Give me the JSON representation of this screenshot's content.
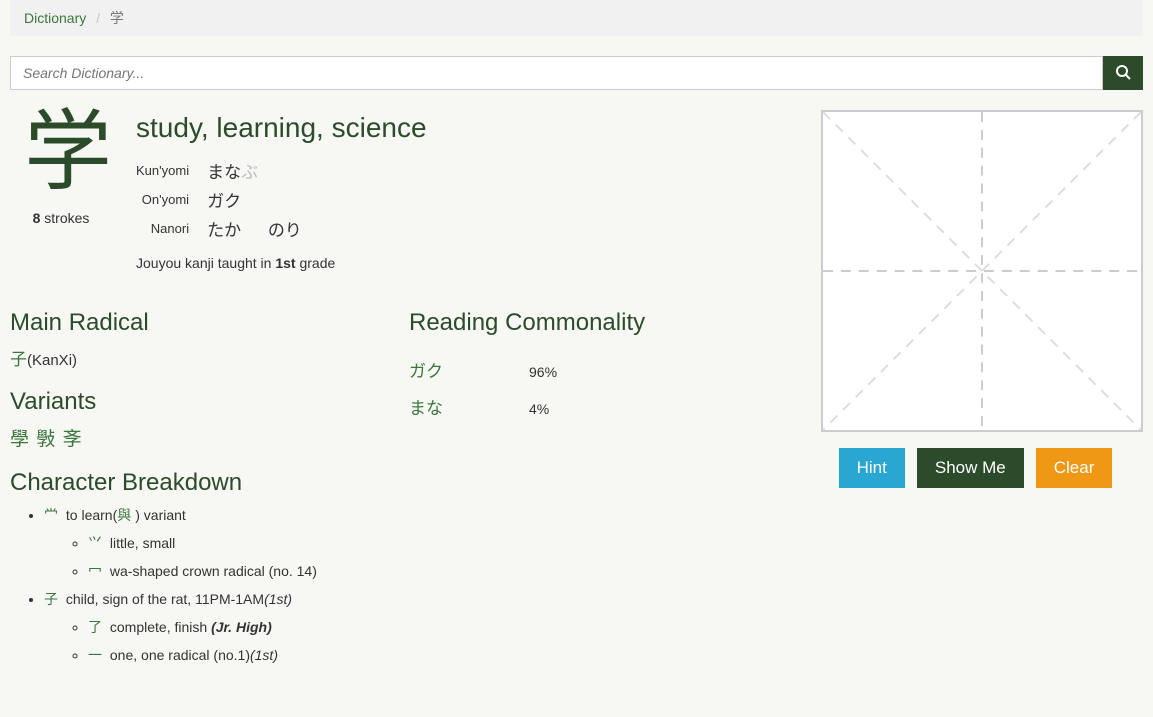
{
  "breadcrumb": {
    "root": "Dictionary",
    "current": "学"
  },
  "search": {
    "placeholder": "Search Dictionary..."
  },
  "kanji": {
    "char": "学",
    "strokes_count": "8",
    "strokes_suffix": " strokes",
    "meaning": "study, learning, science",
    "kun_label": "Kun'yomi",
    "kun_main": "まな",
    "kun_okurigana": "ぶ",
    "on_label": "On'yomi",
    "on": "ガク",
    "nanori_label": "Nanori",
    "nanori1": "たか",
    "nanori2": "のり",
    "grade_prefix": "Jouyou kanji taught in ",
    "grade_num": "1st",
    "grade_suffix": " grade"
  },
  "main_radical": {
    "heading": "Main Radical",
    "char": "子",
    "source": "(KanXi)"
  },
  "variants": {
    "heading": "Variants",
    "v0": "學",
    "v1": "斅",
    "v2": "斈"
  },
  "commonality": {
    "heading": "Reading Commonality",
    "r0_reading": "ガク",
    "r0_val": "96%",
    "r1_reading": "まな",
    "r1_val": "4%"
  },
  "breakdown": {
    "heading": "Character Breakdown",
    "items": [
      {
        "comp": "龸",
        "desc": "to learn(",
        "link": "與",
        "desc2": ") variant",
        "tag": "",
        "children": [
          {
            "comp": "⺍",
            "desc": "little, small",
            "tag": ""
          },
          {
            "comp": "冖",
            "desc": "wa-shaped crown radical (no. 14)",
            "tag": ""
          }
        ]
      },
      {
        "comp": "子",
        "desc": "child, sign of the rat, 11PM-1AM",
        "tag": "(1st)",
        "children": [
          {
            "comp": "了",
            "desc": "complete, finish ",
            "tag": "(Jr. High)"
          },
          {
            "comp": "一",
            "desc": "one, one radical (no.1)",
            "tag": "(1st)"
          }
        ]
      }
    ]
  },
  "practice": {
    "hint_label": "Hint",
    "showme_label": "Show Me",
    "clear_label": "Clear"
  },
  "chart_data": {
    "type": "table",
    "title": "Reading Commonality",
    "categories": [
      "ガク",
      "まな"
    ],
    "values": [
      96,
      4
    ]
  }
}
